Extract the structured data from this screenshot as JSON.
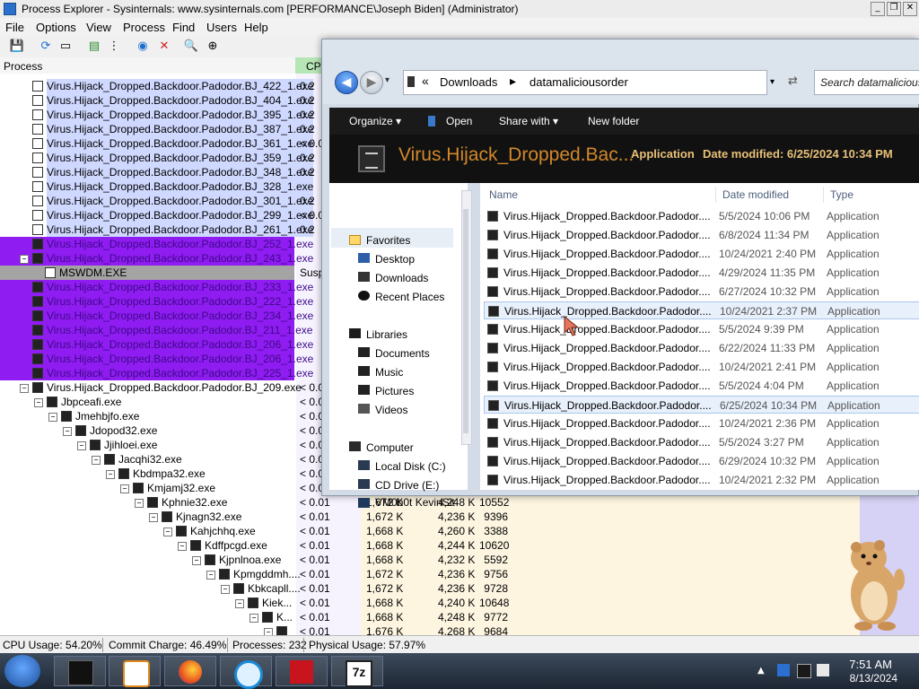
{
  "window": {
    "title": "Process Explorer - Sysinternals: www.sysinternals.com [PERFORMANCE\\Joseph Biden] (Administrator)",
    "controls": [
      "_",
      "❐",
      "✕"
    ]
  },
  "menu": [
    "File",
    "Options",
    "View",
    "Process",
    "Find",
    "Users",
    "Help"
  ],
  "toolbar": {
    "icons": [
      "save-icon",
      "refresh-icon",
      "system-info-icon",
      "graph-icon",
      "tree-icon",
      "target-icon",
      "kill-icon",
      "find-icon",
      "crosshair-icon"
    ]
  },
  "columns": {
    "process": "Process",
    "cpu": "CPU"
  },
  "processes": [
    {
      "name": "Virus.Hijack_Dropped.Backdoor.Padodor.BJ_422_1.exe",
      "cpu": "0.2",
      "style": "svc"
    },
    {
      "name": "Virus.Hijack_Dropped.Backdoor.Padodor.BJ_404_1.exe",
      "cpu": "0.2",
      "style": "svc"
    },
    {
      "name": "Virus.Hijack_Dropped.Backdoor.Padodor.BJ_395_1.exe",
      "cpu": "0.2",
      "style": "svc"
    },
    {
      "name": "Virus.Hijack_Dropped.Backdoor.Padodor.BJ_387_1.exe",
      "cpu": "0.2",
      "style": "svc"
    },
    {
      "name": "Virus.Hijack_Dropped.Backdoor.Padodor.BJ_361_1.exe",
      "cpu": "< 0.0",
      "style": "svc"
    },
    {
      "name": "Virus.Hijack_Dropped.Backdoor.Padodor.BJ_359_1.exe",
      "cpu": "0.2",
      "style": "svc"
    },
    {
      "name": "Virus.Hijack_Dropped.Backdoor.Padodor.BJ_348_1.exe",
      "cpu": "0.2",
      "style": "svc"
    },
    {
      "name": "Virus.Hijack_Dropped.Backdoor.Padodor.BJ_328_1.exe",
      "cpu": "",
      "style": "svc"
    },
    {
      "name": "Virus.Hijack_Dropped.Backdoor.Padodor.BJ_301_1.exe",
      "cpu": "0.2",
      "style": "svc"
    },
    {
      "name": "Virus.Hijack_Dropped.Backdoor.Padodor.BJ_299_1.exe",
      "cpu": "< 0.0",
      "style": "svc"
    },
    {
      "name": "Virus.Hijack_Dropped.Backdoor.Padodor.BJ_261_1.exe",
      "cpu": "0.2",
      "style": "svc"
    },
    {
      "name": "Virus.Hijack_Dropped.Backdoor.Padodor.BJ_252_1.exe",
      "cpu": "",
      "style": "purple"
    },
    {
      "name": "Virus.Hijack_Dropped.Backdoor.Padodor.BJ_243_1.exe",
      "cpu": "",
      "style": "purple",
      "toggle": "−"
    },
    {
      "name": "MSWDM.EXE",
      "cpu": "Susp",
      "style": "susp"
    },
    {
      "name": "Virus.Hijack_Dropped.Backdoor.Padodor.BJ_233_1.exe",
      "cpu": "",
      "style": "purple"
    },
    {
      "name": "Virus.Hijack_Dropped.Backdoor.Padodor.BJ_222_1.exe",
      "cpu": "",
      "style": "purple"
    },
    {
      "name": "Virus.Hijack_Dropped.Backdoor.Padodor.BJ_234_1.exe",
      "cpu": "",
      "style": "purple"
    },
    {
      "name": "Virus.Hijack_Dropped.Backdoor.Padodor.BJ_211_1.exe",
      "cpu": "",
      "style": "purple"
    },
    {
      "name": "Virus.Hijack_Dropped.Backdoor.Padodor.BJ_206_1.exe",
      "cpu": "",
      "style": "purple"
    },
    {
      "name": "Virus.Hijack_Dropped.Backdoor.Padodor.BJ_206_1.exe",
      "cpu": "",
      "style": "purple"
    },
    {
      "name": "Virus.Hijack_Dropped.Backdoor.Padodor.BJ_225_1.exe",
      "cpu": "",
      "style": "purple"
    },
    {
      "name": "Virus.Hijack_Dropped.Backdoor.Padodor.BJ_209.exe",
      "cpu": "< 0.0",
      "style": "tree",
      "toggle": "−"
    },
    {
      "name": "Jbpceafi.exe",
      "cpu": "< 0.0",
      "style": "tree",
      "toggle": "−"
    },
    {
      "name": "Jmehbjfo.exe",
      "cpu": "< 0.0",
      "style": "tree",
      "toggle": "−"
    },
    {
      "name": "Jdopod32.exe",
      "cpu": "< 0.0",
      "style": "tree",
      "toggle": "−"
    },
    {
      "name": "Jjihloei.exe",
      "cpu": "< 0.0",
      "style": "tree",
      "toggle": "−"
    },
    {
      "name": "Jacqhi32.exe",
      "cpu": "< 0.0",
      "style": "tree",
      "toggle": "−"
    },
    {
      "name": "Kbdmpa32.exe",
      "cpu": "< 0.0",
      "style": "tree",
      "toggle": "−"
    },
    {
      "name": "Kmjamj32.exe",
      "cpu": "< 0.0",
      "style": "tree",
      "toggle": "−"
    },
    {
      "name": "Kphnie32.exe",
      "cpu": "< 0.01",
      "private": "1,672 K",
      "working": "4,248 K",
      "pid": "10552",
      "style": "tree",
      "toggle": "−"
    },
    {
      "name": "Kjnagn32.exe",
      "cpu": "< 0.01",
      "private": "1,672 K",
      "working": "4,236 K",
      "pid": "9396",
      "style": "tree",
      "toggle": "−"
    },
    {
      "name": "Kahjchhq.exe",
      "cpu": "< 0.01",
      "private": "1,668 K",
      "working": "4,260 K",
      "pid": "3388",
      "style": "tree",
      "toggle": "−"
    },
    {
      "name": "Kdffpcgd.exe",
      "cpu": "< 0.01",
      "private": "1,668 K",
      "working": "4,244 K",
      "pid": "10620",
      "style": "tree",
      "toggle": "−"
    },
    {
      "name": "Kjpnlnoa.exe",
      "cpu": "< 0.01",
      "private": "1,668 K",
      "working": "4,232 K",
      "pid": "5592",
      "style": "tree",
      "toggle": "−"
    },
    {
      "name": "Kpmgddmh....",
      "cpu": "< 0.01",
      "private": "1,672 K",
      "working": "4,236 K",
      "pid": "9756",
      "style": "tree",
      "toggle": "−"
    },
    {
      "name": "Kbkcapll....",
      "cpu": "< 0.01",
      "private": "1,672 K",
      "working": "4,236 K",
      "pid": "9728",
      "style": "tree",
      "toggle": "−"
    },
    {
      "name": "Kiek...",
      "cpu": "< 0.01",
      "private": "1,668 K",
      "working": "4,240 K",
      "pid": "10648",
      "style": "tree",
      "toggle": "−"
    },
    {
      "name": "K...",
      "cpu": "< 0.01",
      "private": "1,668 K",
      "working": "4,248 K",
      "pid": "9772",
      "style": "tree",
      "toggle": "−"
    },
    {
      "name": "",
      "cpu": "< 0.01",
      "private": "1,676 K",
      "working": "4,268 K",
      "pid": "9684",
      "style": "tree",
      "toggle": "−"
    }
  ],
  "status": {
    "cpu": "CPU Usage: 54.20%",
    "commit": "Commit Charge: 46.49%",
    "processes": "Processes: 232",
    "physical": "Physical Usage: 57.97%"
  },
  "explorer": {
    "breadcrumb": [
      "Downloads",
      "datamaliciousorder"
    ],
    "search_placeholder": "Search datamaliciousorder",
    "commands": [
      "Organize ▾",
      "Open",
      "Share with ▾",
      "New folder"
    ],
    "preview": {
      "name": "Virus.Hijack_Dropped.Bac...",
      "type": "Application",
      "date": "Date modified: 6/25/2024 10:34 PM"
    },
    "nav": {
      "favorites": "Favorites",
      "desktop": "Desktop",
      "downloads": "Downloads",
      "recent": "Recent Places",
      "libraries": "Libraries",
      "documents": "Documents",
      "music": "Music",
      "pictures": "Pictures",
      "videos": "Videos",
      "computer": "Computer",
      "localdisk": "Local Disk (C:)",
      "cddrive": "CD Drive (E:)",
      "share": "VM0b0t KevinSit"
    },
    "headers": {
      "name": "Name",
      "date": "Date modified",
      "type": "Type"
    },
    "files": [
      {
        "name": "Virus.Hijack_Dropped.Backdoor.Padodor....",
        "date": "5/5/2024 10:06 PM",
        "type": "Application"
      },
      {
        "name": "Virus.Hijack_Dropped.Backdoor.Padodor....",
        "date": "6/8/2024 11:34 PM",
        "type": "Application"
      },
      {
        "name": "Virus.Hijack_Dropped.Backdoor.Padodor....",
        "date": "10/24/2021 2:40 PM",
        "type": "Application"
      },
      {
        "name": "Virus.Hijack_Dropped.Backdoor.Padodor....",
        "date": "4/29/2024 11:35 PM",
        "type": "Application"
      },
      {
        "name": "Virus.Hijack_Dropped.Backdoor.Padodor....",
        "date": "6/27/2024 10:32 PM",
        "type": "Application"
      },
      {
        "name": "Virus.Hijack_Dropped.Backdoor.Padodor....",
        "date": "10/24/2021 2:37 PM",
        "type": "Application",
        "hl": true
      },
      {
        "name": "Virus.Hijack_Dropped.Backdoor.Padodor....",
        "date": "5/5/2024 9:39 PM",
        "type": "Application"
      },
      {
        "name": "Virus.Hijack_Dropped.Backdoor.Padodor....",
        "date": "6/22/2024 11:33 PM",
        "type": "Application"
      },
      {
        "name": "Virus.Hijack_Dropped.Backdoor.Padodor....",
        "date": "10/24/2021 2:41 PM",
        "type": "Application"
      },
      {
        "name": "Virus.Hijack_Dropped.Backdoor.Padodor....",
        "date": "5/5/2024 4:04 PM",
        "type": "Application"
      },
      {
        "name": "Virus.Hijack_Dropped.Backdoor.Padodor....",
        "date": "6/25/2024 10:34 PM",
        "type": "Application",
        "hl": true
      },
      {
        "name": "Virus.Hijack_Dropped.Backdoor.Padodor....",
        "date": "10/24/2021 2:36 PM",
        "type": "Application"
      },
      {
        "name": "Virus.Hijack_Dropped.Backdoor.Padodor....",
        "date": "5/5/2024 3:27 PM",
        "type": "Application"
      },
      {
        "name": "Virus.Hijack_Dropped.Backdoor.Padodor....",
        "date": "6/29/2024 10:32 PM",
        "type": "Application"
      },
      {
        "name": "Virus.Hijack_Dropped.Backdoor.Padodor....",
        "date": "10/24/2021 2:32 PM",
        "type": "Application"
      }
    ]
  },
  "taskbar": {
    "time": "7:51 AM",
    "date": "8/13/2024",
    "apps": [
      "terminal-icon",
      "media-player-icon",
      "firefox-icon",
      "search-app-icon",
      "mcafee-icon",
      "7zip-icon"
    ],
    "sevenzip_label": "7z"
  }
}
